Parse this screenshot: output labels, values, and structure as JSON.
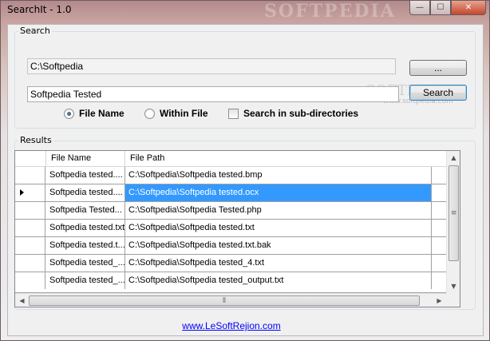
{
  "window": {
    "title": "SearchIt - 1.0",
    "title_watermark": "SOFTPEDIA",
    "controls": {
      "minimize": "—",
      "maximize": "☐",
      "close": "✕"
    }
  },
  "search_group": {
    "legend": "Search",
    "path_value": "C:\\Softpedia",
    "browse_label": "...",
    "query_value": "Softpedia Tested",
    "search_label": "Search",
    "options": {
      "file_name": "File Name",
      "within_file": "Within File",
      "subdirs": "Search in sub-directories"
    },
    "watermark": "SOFTPEDIA",
    "watermark_url": "www.softpedia.com"
  },
  "results_group": {
    "legend": "Results",
    "columns": [
      "File Name",
      "File Path"
    ],
    "rows": [
      {
        "name": "Softpedia tested....",
        "path": "C:\\Softpedia\\Softpedia tested.bmp"
      },
      {
        "name": "Softpedia tested....",
        "path": "C:\\Softpedia\\Softpedia tested.ocx"
      },
      {
        "name": "Softpedia Tested...",
        "path": "C:\\Softpedia\\Softpedia Tested.php"
      },
      {
        "name": "Softpedia tested.txt",
        "path": "C:\\Softpedia\\Softpedia tested.txt"
      },
      {
        "name": "Softpedia tested.t...",
        "path": "C:\\Softpedia\\Softpedia tested.txt.bak"
      },
      {
        "name": "Softpedia tested_...",
        "path": "C:\\Softpedia\\Softpedia tested_4.txt"
      },
      {
        "name": "Softpedia tested_...",
        "path": "C:\\Softpedia\\Softpedia tested_output.txt"
      }
    ],
    "selected_row": 1
  },
  "footer": {
    "link": "www.LeSoftRejion.com"
  }
}
